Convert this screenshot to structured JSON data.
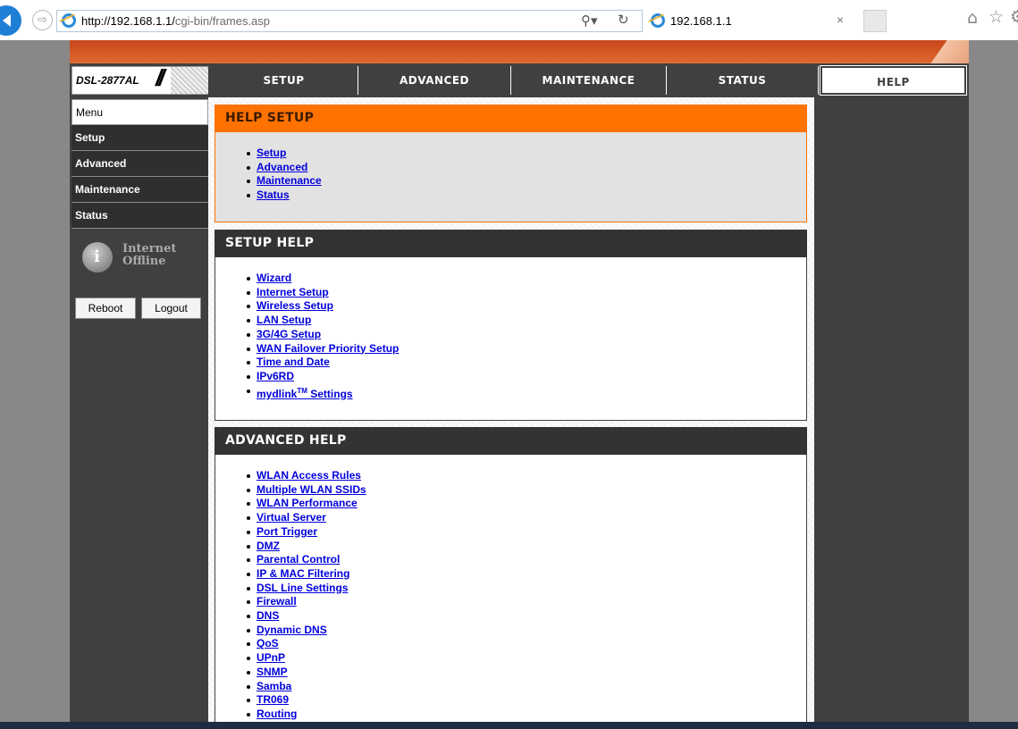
{
  "browser": {
    "url_host": "http://192.168.1.1/",
    "url_path": "cgi-bin/frames.asp",
    "tab_title": "192.168.1.1",
    "icons": [
      "back-icon",
      "forward-icon",
      "ie-logo-icon",
      "search-icon",
      "refresh-icon",
      "close-icon",
      "home-icon",
      "favorites-star-icon",
      "settings-gear-icon"
    ]
  },
  "router": {
    "model": "DSL-2877AL",
    "tabs": [
      "SETUP",
      "ADVANCED",
      "MAINTENANCE",
      "STATUS",
      "HELP"
    ],
    "active_tab": "HELP",
    "sidebar": {
      "menu_label": "Menu",
      "items": [
        "Setup",
        "Advanced",
        "Maintenance",
        "Status"
      ],
      "status_line1": "Internet",
      "status_line2": "Offline",
      "reboot_label": "Reboot",
      "logout_label": "Logout"
    },
    "help_setup": {
      "title": "HELP SETUP",
      "links": [
        "Setup",
        "Advanced",
        "Maintenance",
        "Status"
      ]
    },
    "setup_help": {
      "title": "SETUP HELP",
      "links": [
        "Wizard",
        "Internet Setup",
        "Wireless Setup",
        "LAN Setup",
        "3G/4G Setup",
        "WAN Failover Priority Setup",
        "Time and Date",
        "IPv6RD"
      ],
      "mydlink_prefix": "mydlink",
      "mydlink_sup": "TM",
      "mydlink_suffix": " Settings"
    },
    "advanced_help": {
      "title": "ADVANCED HELP",
      "links": [
        "WLAN Access Rules",
        "Multiple WLAN SSIDs",
        "WLAN Performance",
        "Virtual Server",
        "Port Trigger",
        "DMZ",
        "Parental Control",
        "IP & MAC Filtering",
        "DSL Line Settings",
        "Firewall",
        "DNS",
        "Dynamic DNS",
        "QoS",
        "UPnP",
        "SNMP",
        "Samba",
        "TR069",
        "Routing"
      ]
    },
    "colors": {
      "accent_orange": "#ff7200",
      "dark": "#404040",
      "link": "#0000dd"
    }
  }
}
